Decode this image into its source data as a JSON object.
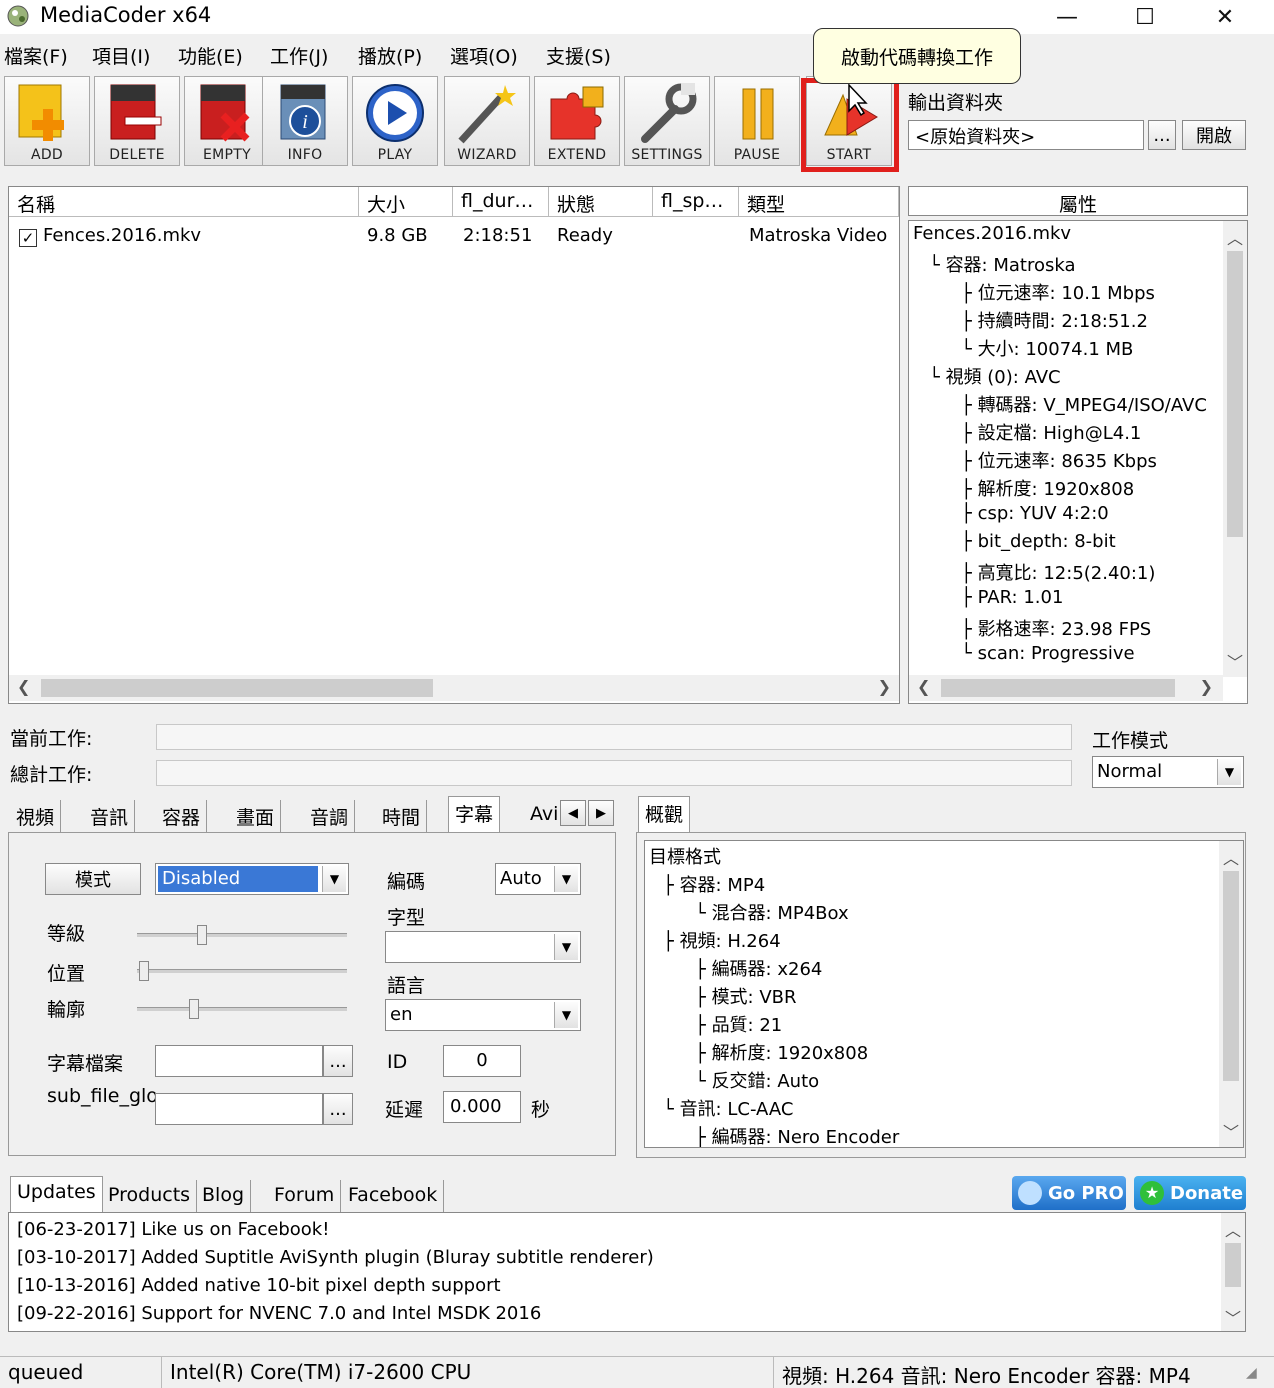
{
  "window": {
    "title": "MediaCoder x64",
    "controls": {
      "minimize": "—",
      "maximize": "☐",
      "close": "✕"
    }
  },
  "menu": [
    "檔案(F)",
    "項目(I)",
    "功能(E)",
    "工作(J)",
    "播放(P)",
    "選項(O)",
    "支援(S)"
  ],
  "toolbar": {
    "buttons": [
      {
        "label": "ADD",
        "icon": "add-icon"
      },
      {
        "label": "DELETE",
        "icon": "delete-icon"
      },
      {
        "label": "EMPTY",
        "icon": "empty-icon"
      },
      {
        "label": "INFO",
        "icon": "info-icon"
      },
      {
        "label": "PLAY",
        "icon": "play-icon"
      },
      {
        "label": "WIZARD",
        "icon": "wizard-icon"
      },
      {
        "label": "EXTEND",
        "icon": "puzzle-icon"
      },
      {
        "label": "SETTINGS",
        "icon": "wrench-icon"
      },
      {
        "label": "PAUSE",
        "icon": "pause-icon"
      },
      {
        "label": "START",
        "icon": "start-icon"
      }
    ],
    "tooltip": "啟動代碼轉換工作",
    "highlight_color": "#e0201c"
  },
  "output_folder": {
    "label": "輸出資料夾",
    "value": "<原始資料夾>",
    "browse": "...",
    "open": "開啟"
  },
  "file_list": {
    "columns": [
      "名稱",
      "大小",
      "fl_dur…",
      "狀態",
      "fl_sp…",
      "類型"
    ],
    "rows": [
      {
        "checked": true,
        "name": "Fences.2016.mkv",
        "size": "9.8 GB",
        "duration": "2:18:51",
        "status": "Ready",
        "speed": "",
        "type": "Matroska Video"
      }
    ]
  },
  "properties": {
    "header": "屬性",
    "tree": [
      "Fences.2016.mkv",
      "容器: Matroska",
      "位元速率: 10.1 Mbps",
      "持續時間: 2:18:51.2",
      "大小: 10074.1 MB",
      "視頻 (0): AVC",
      "轉碼器: V_MPEG4/ISO/AVC",
      "設定檔: High@L4.1",
      "位元速率: 8635 Kbps",
      "解析度: 1920x808",
      "csp: YUV 4:2:0",
      "bit_depth: 8-bit",
      "高寬比: 12:5(2.40:1)",
      "PAR: 1.01",
      "影格速率: 23.98 FPS",
      "scan: Progressive"
    ]
  },
  "jobs": {
    "current_label": "當前工作:",
    "total_label": "總計工作:",
    "mode_label": "工作模式",
    "mode_value": "Normal"
  },
  "settings_tabs": [
    "視頻",
    "音訊",
    "容器",
    "畫面",
    "音調",
    "時間",
    "字幕",
    "Avi"
  ],
  "subtitle": {
    "mode_button": "模式",
    "mode_value": "Disabled",
    "level_label": "等級",
    "position_label": "位置",
    "outline_label": "輪廓",
    "file_label": "字幕檔案",
    "sub_file_label": "sub_file_glo",
    "encoding_label": "編碼",
    "encoding_value": "Auto",
    "font_label": "字型",
    "font_value": "",
    "language_label": "語言",
    "language_value": "en",
    "id_label": "ID",
    "id_value": "0",
    "delay_label": "延遲",
    "delay_value": "0.000",
    "delay_unit": "秒",
    "browse": "..."
  },
  "preview": {
    "tab": "概觀",
    "tree": [
      "目標格式",
      "容器: MP4",
      "混合器: MP4Box",
      "視頻: H.264",
      "編碼器: x264",
      "模式: VBR",
      "品質: 21",
      "解析度: 1920x808",
      "反交錯: Auto",
      "音訊: LC-AAC",
      "編碼器: Nero Encoder"
    ]
  },
  "bottom_tabs": [
    "Updates",
    "Products",
    "Blog",
    "Forum",
    "Facebook"
  ],
  "promo": {
    "gopro": "Go PRO",
    "donate": "Donate"
  },
  "news": [
    "[06-23-2017] Like us on Facebook!",
    "[03-10-2017] Added Suptitle AviSynth plugin (Bluray subtitle renderer)",
    "[10-13-2016] Added native 10-bit pixel depth support",
    "[09-22-2016] Support for NVENC 7.0 and Intel MSDK 2016"
  ],
  "status_bar": {
    "queue": "queued",
    "cpu": "Intel(R) Core(TM) i7-2600 CPU",
    "summary": "視頻: H.264  音訊: Nero Encoder  容器: MP4"
  }
}
